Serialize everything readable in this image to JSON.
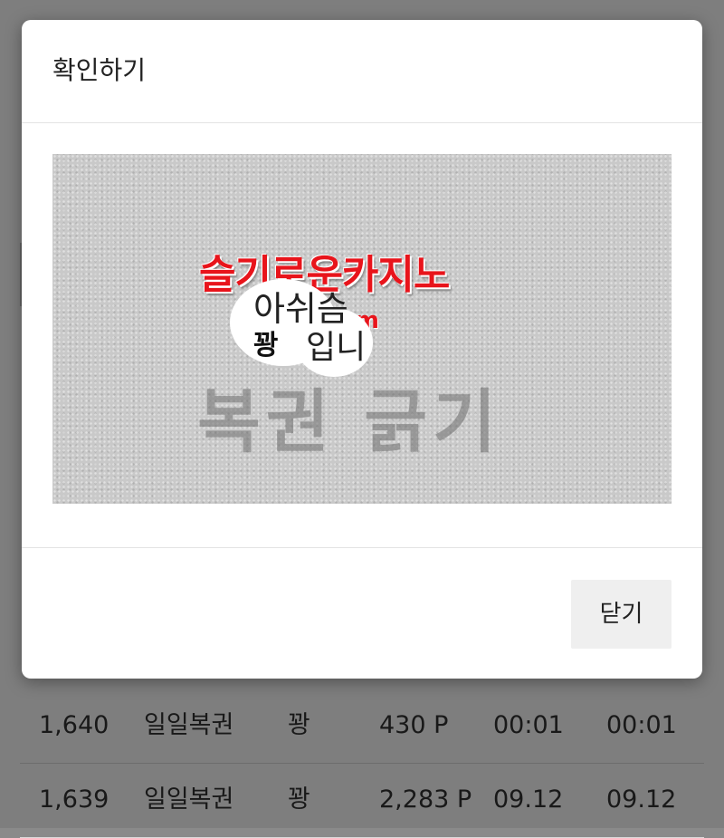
{
  "modal": {
    "title": "확인하기",
    "close_label": "닫기"
  },
  "captcha": {
    "brand": "슬기로운카지노",
    "domain": "om",
    "challenge_line1": "아쉬슴",
    "challenge_line2_bold": "꽝",
    "challenge_line2": "입니",
    "caption": "복권 긁기"
  },
  "table": {
    "rows": [
      [
        "1,640",
        "일일복권",
        "꽝",
        "430 P",
        "00:01",
        "00:01"
      ],
      [
        "1,639",
        "일일복권",
        "꽝",
        "2,283 P",
        "09.12",
        "09.12"
      ]
    ]
  },
  "colors": {
    "brand_red": "#e8141b",
    "overlay": "rgba(0,0,0,0.5)",
    "close_button_bg": "#efefef"
  }
}
